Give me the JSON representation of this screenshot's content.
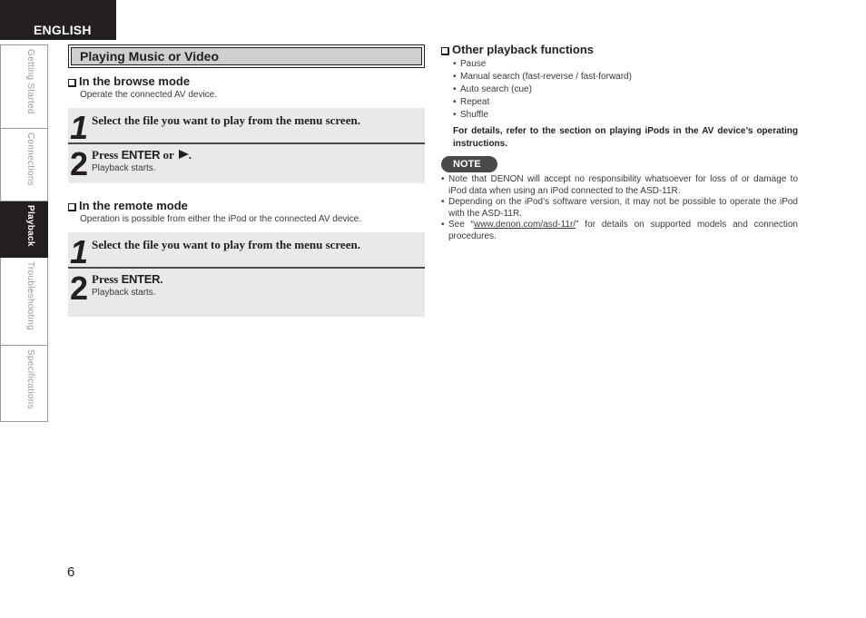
{
  "header": {
    "language": "ENGLISH"
  },
  "sidenav": {
    "items": [
      {
        "label": "Getting Started",
        "active": false
      },
      {
        "label": "Connections",
        "active": false
      },
      {
        "label": "Playback",
        "active": true
      },
      {
        "label": "Troubleshooting",
        "active": false
      },
      {
        "label": "Specifications",
        "active": false
      }
    ]
  },
  "left": {
    "section_title": "Playing Music or Video",
    "browse": {
      "heading": "In the browse mode",
      "description": "Operate the connected AV device.",
      "steps": [
        {
          "number": "1",
          "text": "Select the file you want to play from the menu screen."
        },
        {
          "number": "2",
          "prefix": "Press ",
          "key": "ENTER",
          "suffix": " or ",
          "end": ".",
          "icon": "play-icon",
          "sub": "Playback starts."
        }
      ]
    },
    "remote": {
      "heading": "In the remote mode",
      "description": "Operation is possible from either the iPod or the connected AV device.",
      "steps": [
        {
          "number": "1",
          "text": "Select the file you want to play from the menu screen."
        },
        {
          "number": "2",
          "prefix": "Press ",
          "key": "ENTER",
          "end": ".",
          "sub": "Playback starts."
        }
      ]
    }
  },
  "right": {
    "heading": "Other playback functions",
    "functions": [
      "Pause",
      "Manual search (fast-reverse / fast-forward)",
      "Auto search (cue)",
      "Repeat",
      "Shuffle"
    ],
    "details": "For details, refer to the section on playing iPods in the AV device’s operating instructions.",
    "note_label": "NOTE",
    "notes": [
      "Note that DENON will accept no responsibility whatsoever for loss of or damage to iPod data when using an iPod connected to the ASD-11R.",
      "Depending on the iPod’s software version, it may not be possible to operate the iPod with the ASD-11R."
    ],
    "note_link": {
      "before": "See “",
      "link": "www.denon.com/asd-11r/",
      "after": "” for details on supported models and connection procedures."
    }
  },
  "footer": {
    "page_number": "6"
  }
}
